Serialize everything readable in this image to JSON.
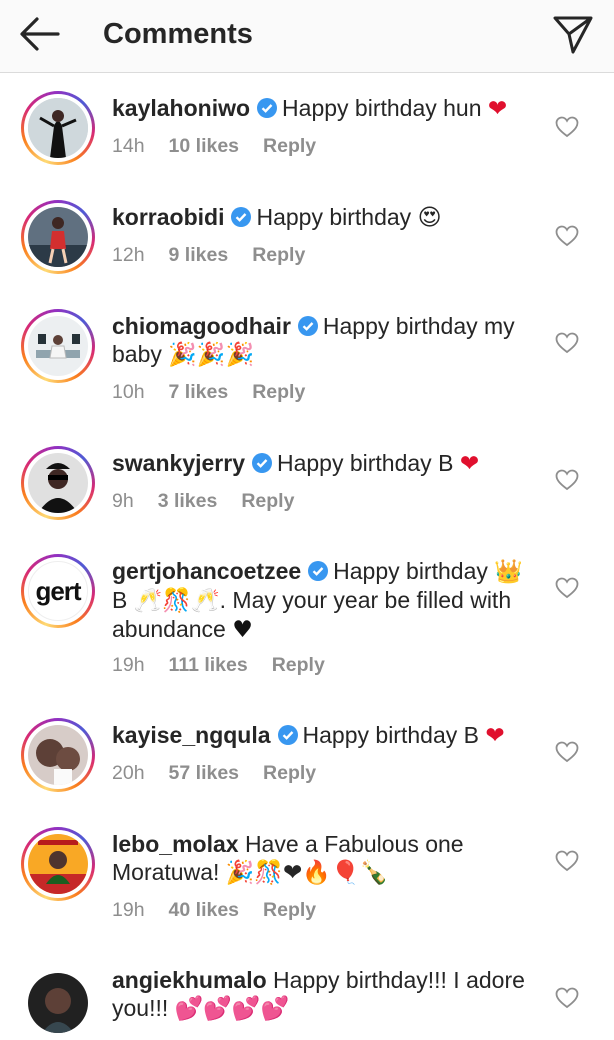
{
  "header": {
    "title": "Comments",
    "back_icon": "arrow-left-icon",
    "share_icon": "paper-plane-icon"
  },
  "comments": [
    {
      "username": "kaylahoniwo",
      "verified": true,
      "text": "Happy birthday hun",
      "emoji": "❤",
      "time": "14h",
      "likes": "10 likes",
      "reply": "Reply"
    },
    {
      "username": "korraobidi",
      "verified": true,
      "text": "Happy birthday",
      "emoji": "😍",
      "time": "12h",
      "likes": "9 likes",
      "reply": "Reply"
    },
    {
      "username": "chiomagoodhair",
      "verified": true,
      "text": "Happy birthday my",
      "text2": "baby",
      "emoji": "🎉🎉🎉",
      "time": "10h",
      "likes": "7 likes",
      "reply": "Reply"
    },
    {
      "username": "swankyjerry",
      "verified": true,
      "text": "Happy birthday B",
      "emoji": "❤",
      "time": "9h",
      "likes": "3 likes",
      "reply": "Reply"
    },
    {
      "username": "gertjohancoetzee",
      "verified": true,
      "text": "Happy birthday",
      "emoji_crown": "👑",
      "line2_pre": "B",
      "line2_emoji": "🥂🎊🥂",
      "line2_post": ". May your year be filled with",
      "line3": "abundance",
      "line3_emoji": "♥",
      "avatar_text": "gert",
      "time": "19h",
      "likes": "111 likes",
      "reply": "Reply"
    },
    {
      "username": "kayise_ngqula",
      "verified": true,
      "text": "Happy birthday B",
      "emoji": "❤",
      "time": "20h",
      "likes": "57 likes",
      "reply": "Reply"
    },
    {
      "username": "lebo_molax",
      "verified": false,
      "text": "Have a Fabulous one",
      "text2": "Moratuwa!",
      "emoji": "🎉🎊❤🔥🎈🍾",
      "time": "19h",
      "likes": "40 likes",
      "reply": "Reply"
    },
    {
      "username": "angiekhumalo",
      "verified": false,
      "text": "Happy birthday!!! I adore",
      "text2": "you!!!",
      "emoji": "💕💕💕💕"
    }
  ],
  "colors": {
    "verified": "#3897f0",
    "muted": "#8e8e8e",
    "text": "#262626",
    "heart": "#e0102e"
  }
}
